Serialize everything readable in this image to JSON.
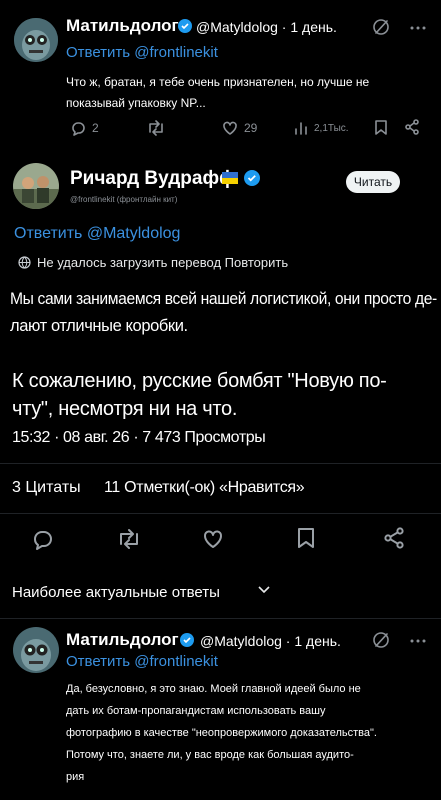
{
  "reply_top": {
    "author": "Матильдолог",
    "handle_time": "@Matyldolog · 1 день.",
    "replying_to": "Ответить @frontlinekit",
    "text_line1": "Что ж, братан, я тебе очень признателен, но лучше не",
    "text_line2": "показывай упаковку NP...",
    "replies": "2",
    "likes": "29",
    "views": "2,1Тыс."
  },
  "main_tweet": {
    "author": "Ричард Вудрафф",
    "handle": "@frontlinekit (фронтлайн кит)",
    "read_button": "Читать",
    "replying_to": "Ответить @Matyldolog",
    "translate_error": "Не удалось загрузить перевод Повторить",
    "para1_line1": "Мы сами занимаемся всей нашей логистикой, они просто де-",
    "para1_line2": "лают отличные коробки.",
    "para2_line1": "К сожалению, русские бомбят \"Новую по-",
    "para2_line2": "чту\", несмотря ни на что.",
    "meta": "15:32 · 08 авг. 26 · 7 473 Просмотры",
    "quotes": "3 Цитаты",
    "likes_label": "11 Отметки(-ок) «Нравится»"
  },
  "replies_header": "Наиболее актуальные ответы",
  "reply_bottom": {
    "author": "Матильдолог",
    "handle_time": "@Matyldolog · 1 день.",
    "replying_to": "Ответить @frontlinekit",
    "line1": "Да, безусловно, я это знаю. Моей главной идеей было не",
    "line2": "дать их ботам-пропагандистам использовать вашу",
    "line3": "фотографию в качестве \"неопровержимого доказательства\".",
    "line4": "Потому что, знаете ли, у вас вроде как большая аудито-",
    "line5": "рия"
  },
  "colors": {
    "link": "#3b91e0",
    "verified": "#1d9bf0",
    "background": "#000000"
  }
}
